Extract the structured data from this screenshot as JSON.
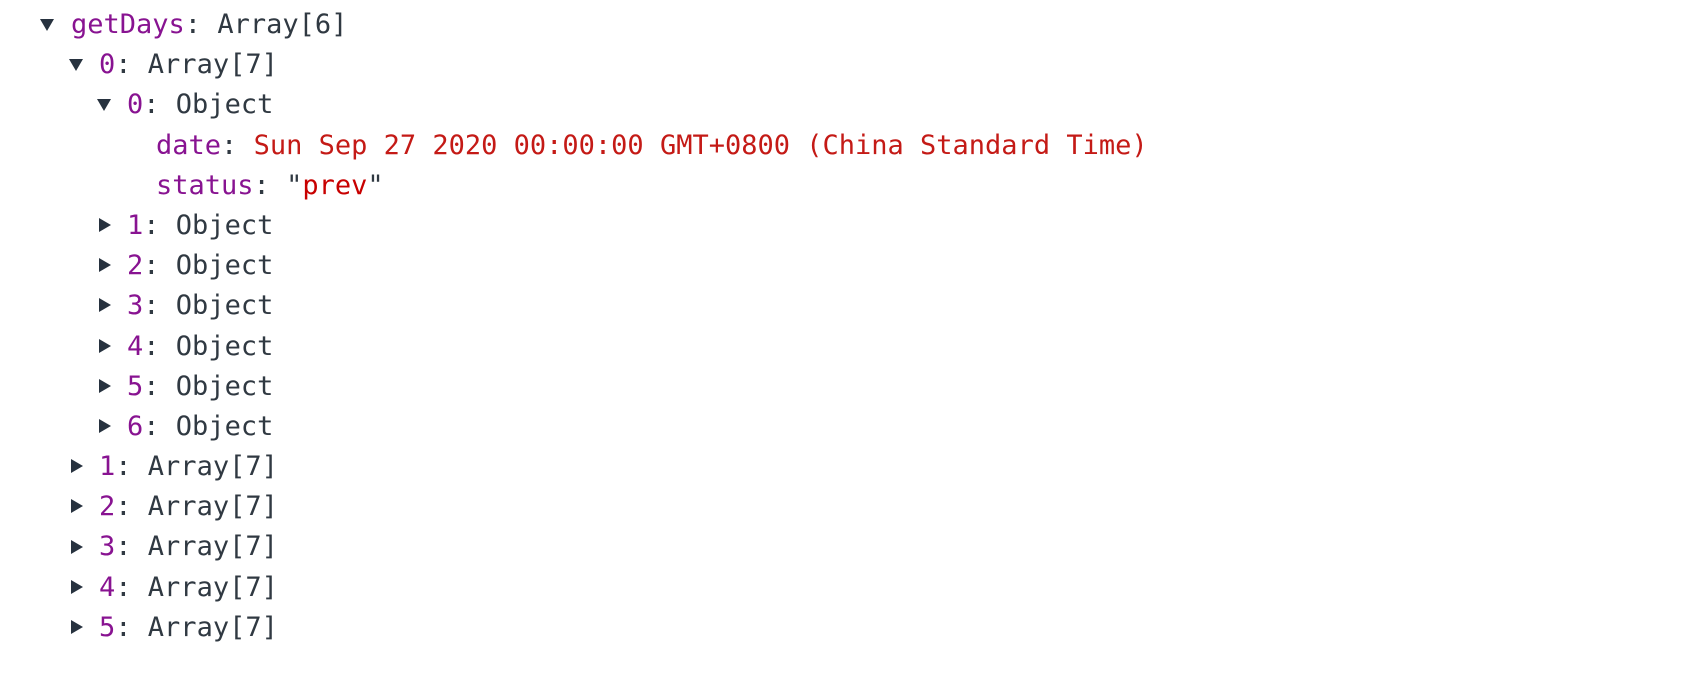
{
  "tree": {
    "root": {
      "key": "getDays",
      "sep": ":",
      "value": "Array[6]"
    },
    "group0": {
      "key": "0",
      "sep": ":",
      "value": "Array[7]"
    },
    "item0": {
      "key": "0",
      "sep": ":",
      "value": "Object"
    },
    "date_prop": {
      "key": "date",
      "sep": ":",
      "value": "Sun Sep 27 2020 00:00:00 GMT+0800 (China Standard Time)"
    },
    "status_prop": {
      "key": "status",
      "sep": ":",
      "quote": "\"",
      "value": "prev"
    },
    "items": [
      {
        "key": "1",
        "sep": ":",
        "value": "Object"
      },
      {
        "key": "2",
        "sep": ":",
        "value": "Object"
      },
      {
        "key": "3",
        "sep": ":",
        "value": "Object"
      },
      {
        "key": "4",
        "sep": ":",
        "value": "Object"
      },
      {
        "key": "5",
        "sep": ":",
        "value": "Object"
      },
      {
        "key": "6",
        "sep": ":",
        "value": "Object"
      }
    ],
    "groups": [
      {
        "key": "1",
        "sep": ":",
        "value": "Array[7]"
      },
      {
        "key": "2",
        "sep": ":",
        "value": "Array[7]"
      },
      {
        "key": "3",
        "sep": ":",
        "value": "Array[7]"
      },
      {
        "key": "4",
        "sep": ":",
        "value": "Array[7]"
      },
      {
        "key": "5",
        "sep": ":",
        "value": "Array[7]"
      }
    ]
  },
  "colors": {
    "key": "#881391",
    "text": "#303942",
    "string": "#c80000",
    "toggle": "#27323f"
  },
  "icons": {
    "expanded": "triangle-down-icon",
    "collapsed": "triangle-right-icon"
  }
}
